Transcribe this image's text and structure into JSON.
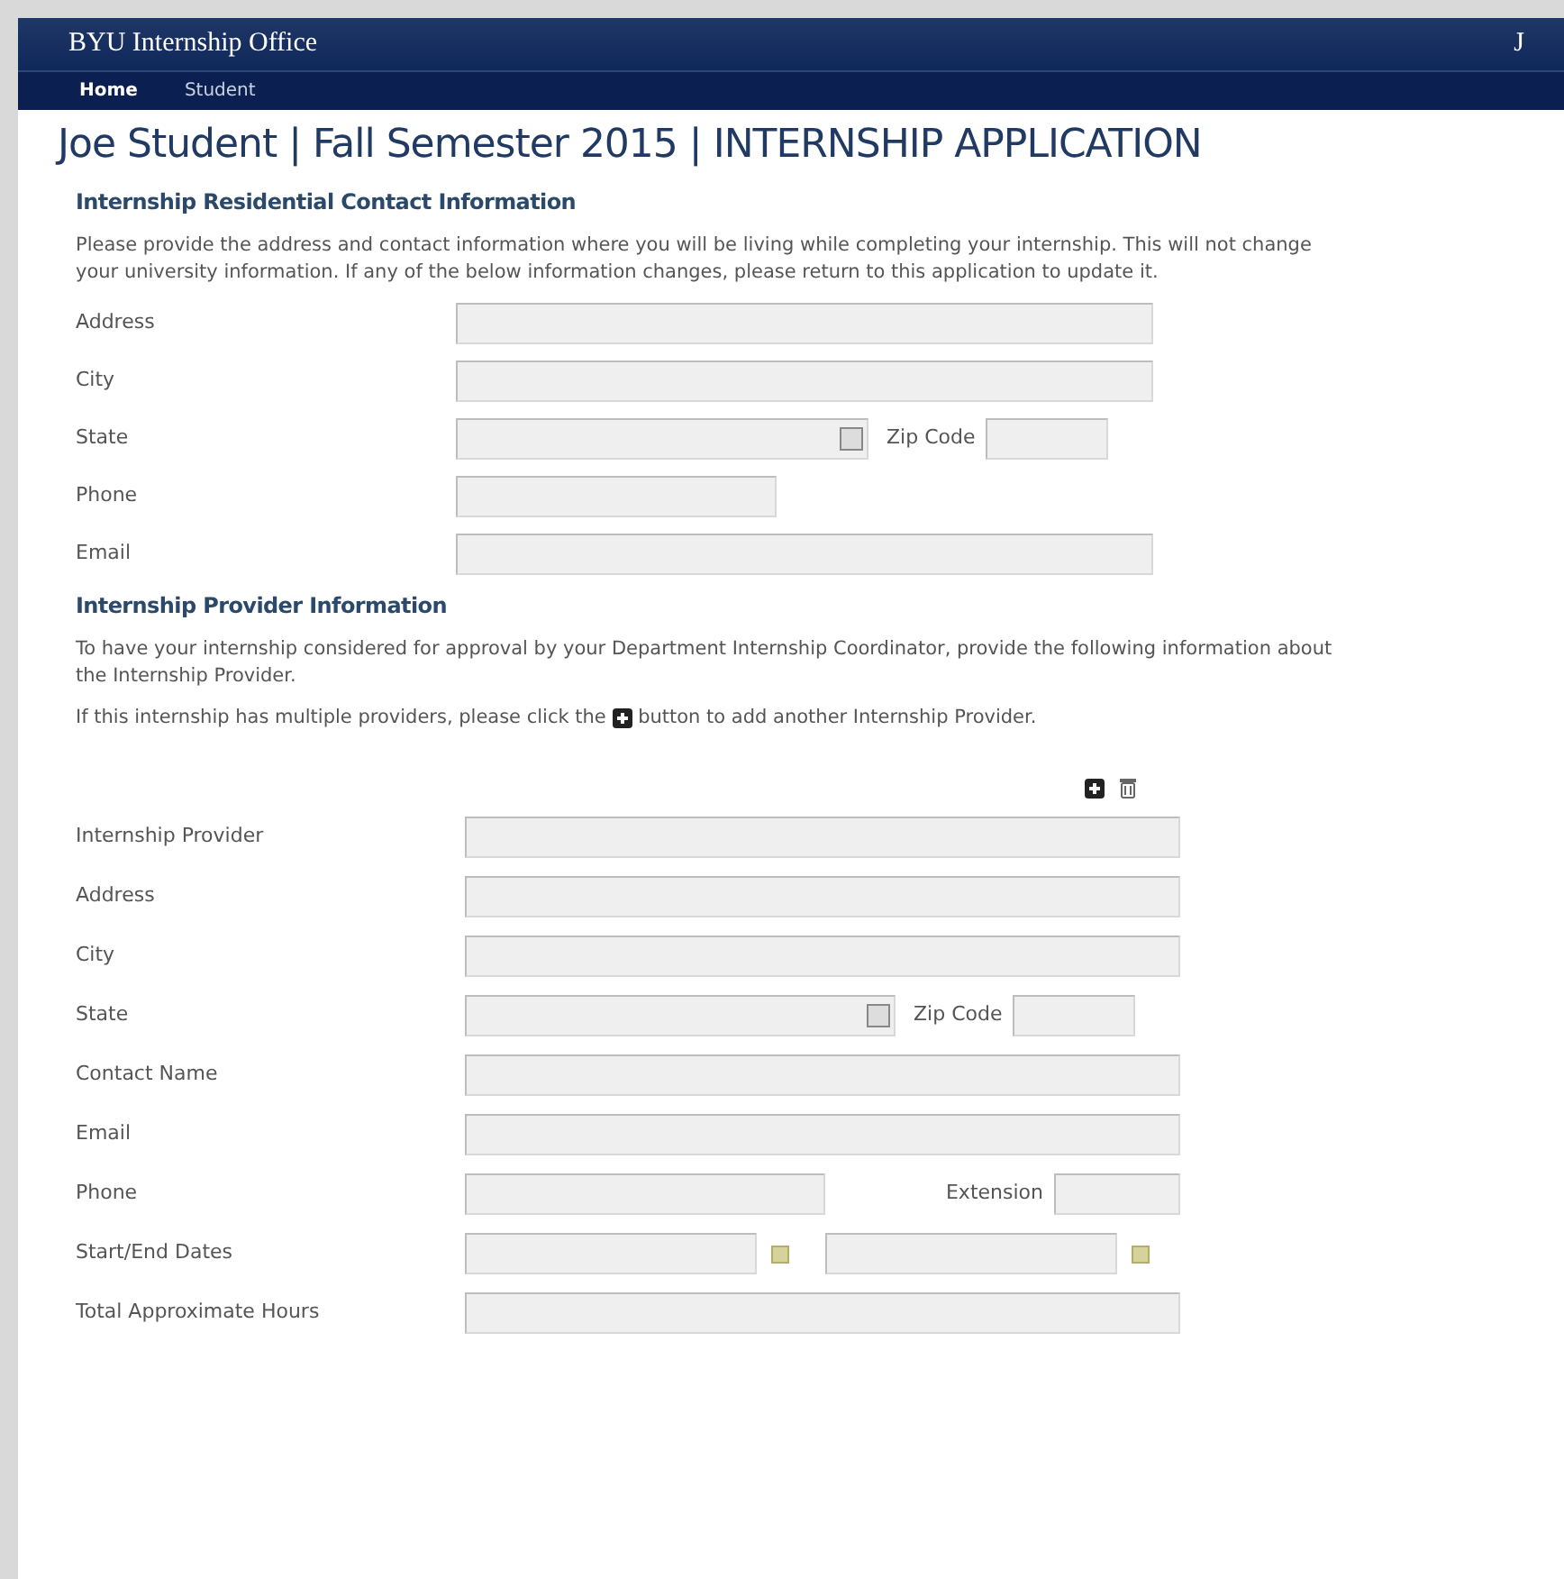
{
  "header": {
    "title": "BYU Internship Office",
    "user": "J"
  },
  "nav": [
    {
      "label": "Home",
      "selected": true
    },
    {
      "label": "Student",
      "selected": false
    }
  ],
  "page_title": "Joe Student | Fall Semester 2015 | INTERNSHIP APPLICATION",
  "residential": {
    "heading": "Internship Residential Contact Information",
    "intro": "Please provide the address and contact information where you will be living while completing your internship. This will not change your university information. If any of the below information changes, please return to this application to update it.",
    "fields": [
      {
        "kind": "text",
        "label": "Address"
      },
      {
        "kind": "text",
        "label": "City"
      },
      {
        "kind": "state_zip",
        "label": "State",
        "extra_label": "Zip Code"
      },
      {
        "kind": "short",
        "label": "Phone"
      },
      {
        "kind": "text",
        "label": "Email"
      }
    ]
  },
  "provider": {
    "heading": "Internship Provider Information",
    "intro": "To have your internship considered for approval by your Department Internship Coordinator, provide the following information about the Internship Provider.",
    "note_before": "If this internship has multiple providers, please click the",
    "note_after": "button to add another Internship Provider.",
    "fields": [
      {
        "kind": "text",
        "label": "Internship Provider"
      },
      {
        "kind": "text",
        "label": "Address"
      },
      {
        "kind": "text",
        "label": "City"
      },
      {
        "kind": "state_zip",
        "label": "State",
        "extra_label": "Zip Code"
      },
      {
        "kind": "text",
        "label": "Contact Name"
      },
      {
        "kind": "text",
        "label": "Email"
      },
      {
        "kind": "phone_ext",
        "label": "Phone",
        "extra_label": "Extension"
      },
      {
        "kind": "dates",
        "label": "Start/End Dates"
      },
      {
        "kind": "text",
        "label": "Total Approximate Hours"
      }
    ]
  }
}
